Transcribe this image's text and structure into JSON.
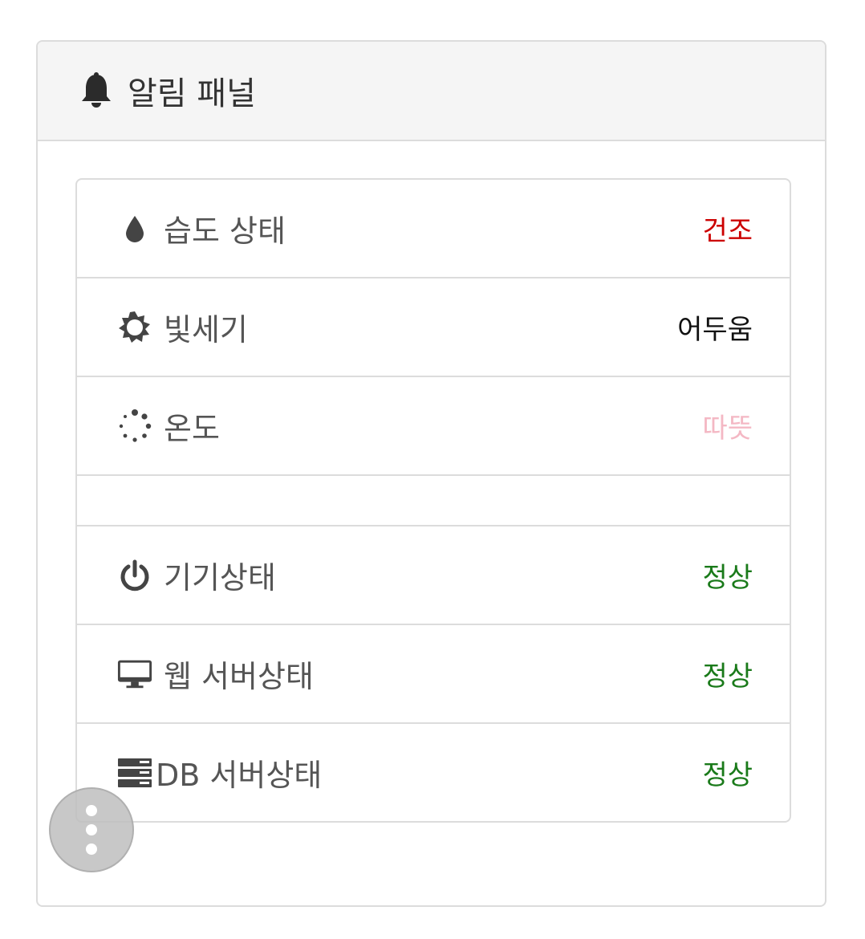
{
  "panel": {
    "title": "알림 패널",
    "title_icon": "bell-icon"
  },
  "rows": [
    {
      "label": "습도 상태",
      "value": "건조",
      "icon": "droplet-icon",
      "value_color": "#cc0000"
    },
    {
      "label": "빛세기",
      "value": "어두움",
      "icon": "sun-icon",
      "value_color": "#111111"
    },
    {
      "label": "온도",
      "value": "따뜻",
      "icon": "spinner-icon",
      "value_color": "#f4b8c4"
    },
    {
      "label": "기기상태",
      "value": "정상",
      "icon": "power-icon",
      "value_color": "#1a7a1a"
    },
    {
      "label": "웹 서버상태",
      "value": "정상",
      "icon": "monitor-icon",
      "value_color": "#1a7a1a"
    },
    {
      "label": "DB 서버상태",
      "value": "정상",
      "icon": "server-icon",
      "value_color": "#1a7a1a"
    }
  ],
  "fab": {
    "icon": "more-vertical-icon"
  }
}
